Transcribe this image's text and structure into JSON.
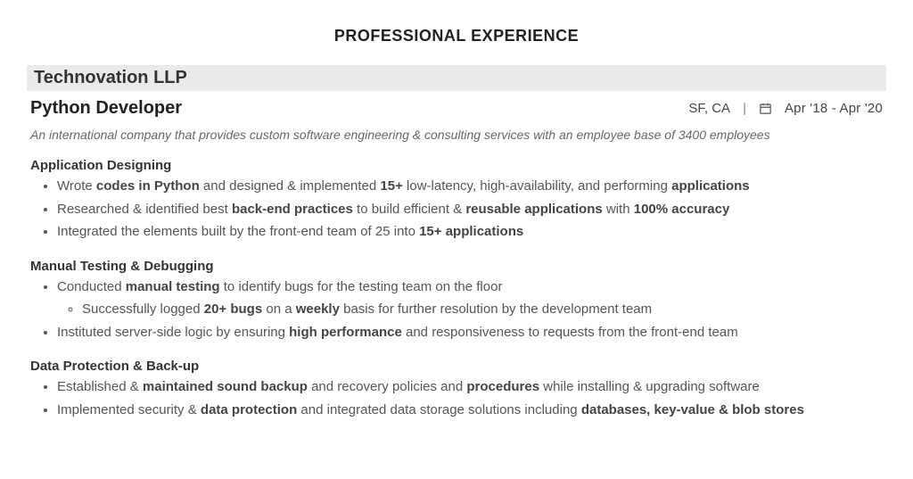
{
  "section_title": "PROFESSIONAL EXPERIENCE",
  "company": "Technovation LLP",
  "role": "Python Developer",
  "location": "SF, CA",
  "date_range": "Apr '18  -  Apr '20",
  "summary": "An international company that provides custom software engineering & consulting services with an employee base of 3400 employees",
  "groups": {
    "app_design": {
      "heading": "Application Designing",
      "b1_a": "Wrote ",
      "b1_b": "codes in Python",
      "b1_c": " and designed & implemented ",
      "b1_d": "15+",
      "b1_e": " low-latency, high-availability, and performing ",
      "b1_f": "applications",
      "b2_a": "Researched & identified best ",
      "b2_b": "back-end practices",
      "b2_c": " to build efficient & ",
      "b2_d": "reusable applications",
      "b2_e": " with ",
      "b2_f": "100% accuracy",
      "b3_a": "Integrated the elements built by the front-end team of 25 into ",
      "b3_b": "15+ applications"
    },
    "testing": {
      "heading": "Manual Testing & Debugging",
      "b1_a": "Conducted ",
      "b1_b": "manual testing",
      "b1_c": " to identify bugs for the testing team on the floor",
      "s1_a": "Successfully logged ",
      "s1_b": "20+ bugs",
      "s1_c": " on a ",
      "s1_d": "weekly",
      "s1_e": " basis for further resolution by the development team",
      "b2_a": "Instituted server-side logic by ensuring ",
      "b2_b": "high performance",
      "b2_c": " and responsiveness to requests from the front-end team"
    },
    "data": {
      "heading": "Data Protection & Back-up",
      "b1_a": "Established & ",
      "b1_b": "maintained sound backup",
      "b1_c": " and recovery policies and ",
      "b1_d": "procedures",
      "b1_e": " while installing & upgrading software",
      "b2_a": "Implemented security & ",
      "b2_b": "data protection",
      "b2_c": " and integrated data storage solutions including ",
      "b2_d": "databases, key-value & blob stores"
    }
  }
}
